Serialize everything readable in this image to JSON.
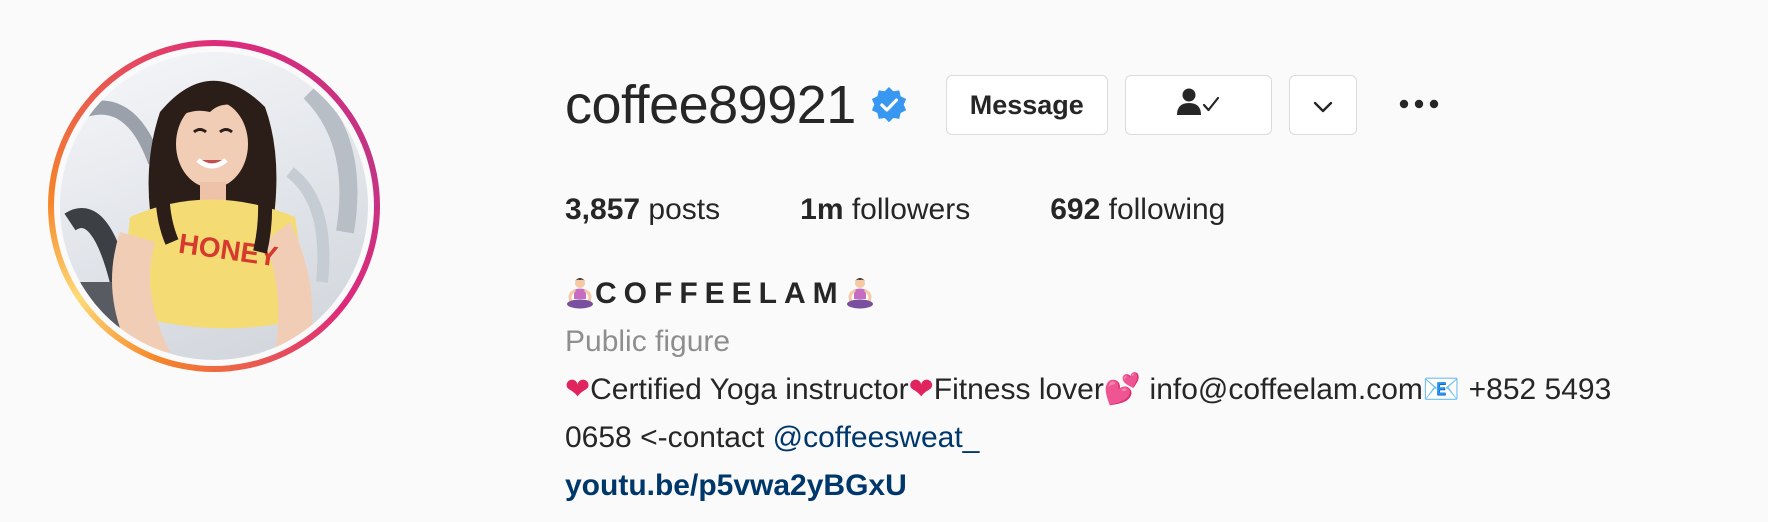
{
  "profile": {
    "username": "coffee89921",
    "verified": true,
    "accent_color": "#3897f0"
  },
  "actions": {
    "message_label": "Message",
    "following_icon": "person-check-icon",
    "dropdown_icon": "chevron-down-icon",
    "more_icon": "more-horizontal-icon"
  },
  "stats": {
    "posts_count": "3,857",
    "posts_label": "posts",
    "followers_count": "1m",
    "followers_label": "followers",
    "following_count": "692",
    "following_label": "following"
  },
  "bio": {
    "display_name": "COFFEELAM",
    "category": "Public figure",
    "line1": {
      "heart_1": "❤",
      "text_1": "Certified Yoga instructor",
      "heart_2": "❤",
      "text_2": "Fitness lover",
      "emoji_hearts": "💕",
      "text_3": " info@coffeelam.com",
      "emoji_mail": "📧",
      "text_4": " +852 5493"
    },
    "line2": {
      "text": "0658 <-contact ",
      "mention": "@coffeesweat_"
    },
    "link": "youtu.be/p5vwa2yBGxU"
  },
  "colors": {
    "link": "#00376b",
    "muted": "#8e8e8e",
    "heart": "#e0245e"
  }
}
